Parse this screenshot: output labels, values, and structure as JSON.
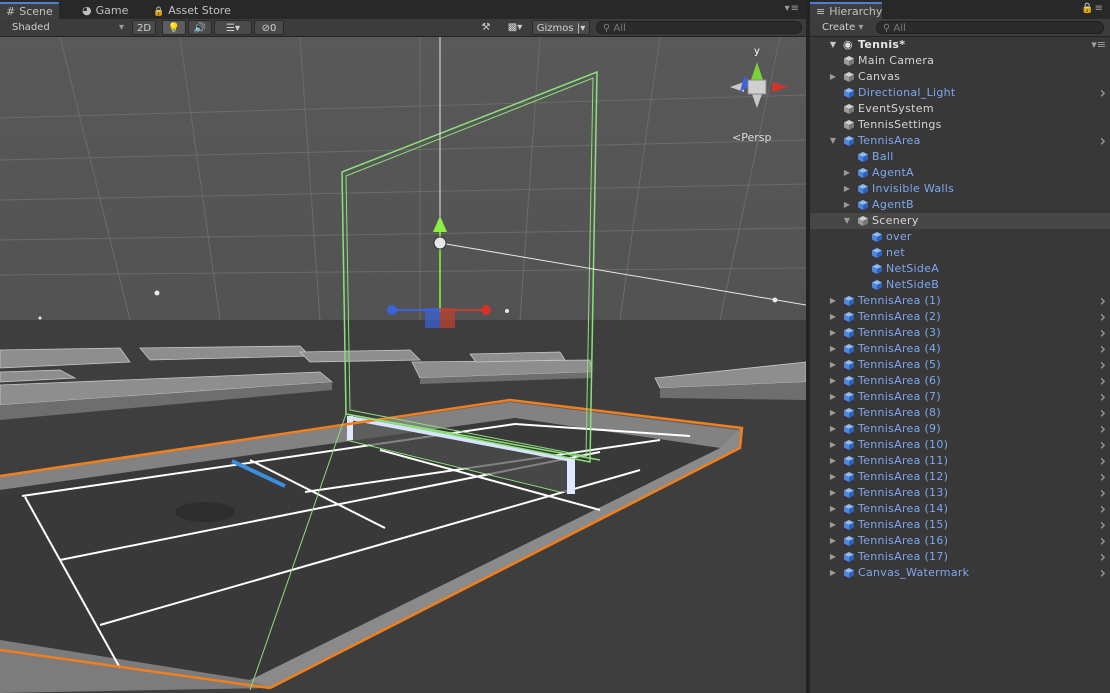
{
  "scene_panel": {
    "tabs": [
      {
        "label": "Scene",
        "icon": "grid-icon",
        "active": true
      },
      {
        "label": "Game",
        "icon": "pacman-icon",
        "active": false
      },
      {
        "label": "Asset Store",
        "icon": "lock-icon",
        "active": false
      }
    ],
    "toolbar": {
      "shading_mode": "Shaded",
      "mode_2d": "2D",
      "hidden_count": "0",
      "gizmos_label": "Gizmos",
      "search_placeholder": "All"
    },
    "view_mode": "Persp",
    "gizmo_axis_label": "y"
  },
  "hierarchy": {
    "title": "Hierarchy",
    "create_label": "Create",
    "search_placeholder": "All",
    "scene_name": "Tennis*",
    "rows": [
      {
        "label": "Main Camera",
        "depth": 1,
        "expander": "none",
        "prefab": false,
        "selected": false
      },
      {
        "label": "Canvas",
        "depth": 1,
        "expander": "collapsed",
        "prefab": false,
        "selected": false
      },
      {
        "label": "Directional_Light",
        "depth": 1,
        "expander": "none",
        "prefab": true,
        "selected": false,
        "more": true
      },
      {
        "label": "EventSystem",
        "depth": 1,
        "expander": "none",
        "prefab": false,
        "selected": false
      },
      {
        "label": "TennisSettings",
        "depth": 1,
        "expander": "none",
        "prefab": false,
        "selected": false
      },
      {
        "label": "TennisArea",
        "depth": 1,
        "expander": "expanded",
        "prefab": true,
        "selected": false,
        "more": true
      },
      {
        "label": "Ball",
        "depth": 2,
        "expander": "none",
        "prefab": true,
        "selected": false
      },
      {
        "label": "AgentA",
        "depth": 2,
        "expander": "collapsed",
        "prefab": true,
        "selected": false
      },
      {
        "label": "Invisible Walls",
        "depth": 2,
        "expander": "collapsed",
        "prefab": true,
        "selected": false
      },
      {
        "label": "AgentB",
        "depth": 2,
        "expander": "collapsed",
        "prefab": true,
        "selected": false
      },
      {
        "label": "Scenery",
        "depth": 2,
        "expander": "expanded",
        "prefab": false,
        "selected": true
      },
      {
        "label": "over",
        "depth": 3,
        "expander": "none",
        "prefab": true,
        "selected": false
      },
      {
        "label": "net",
        "depth": 3,
        "expander": "none",
        "prefab": true,
        "selected": false
      },
      {
        "label": "NetSideA",
        "depth": 3,
        "expander": "none",
        "prefab": true,
        "selected": false
      },
      {
        "label": "NetSideB",
        "depth": 3,
        "expander": "none",
        "prefab": true,
        "selected": false
      },
      {
        "label": "TennisArea (1)",
        "depth": 1,
        "expander": "collapsed",
        "prefab": true,
        "selected": false,
        "more": true
      },
      {
        "label": "TennisArea (2)",
        "depth": 1,
        "expander": "collapsed",
        "prefab": true,
        "selected": false,
        "more": true
      },
      {
        "label": "TennisArea (3)",
        "depth": 1,
        "expander": "collapsed",
        "prefab": true,
        "selected": false,
        "more": true
      },
      {
        "label": "TennisArea (4)",
        "depth": 1,
        "expander": "collapsed",
        "prefab": true,
        "selected": false,
        "more": true
      },
      {
        "label": "TennisArea (5)",
        "depth": 1,
        "expander": "collapsed",
        "prefab": true,
        "selected": false,
        "more": true
      },
      {
        "label": "TennisArea (6)",
        "depth": 1,
        "expander": "collapsed",
        "prefab": true,
        "selected": false,
        "more": true
      },
      {
        "label": "TennisArea (7)",
        "depth": 1,
        "expander": "collapsed",
        "prefab": true,
        "selected": false,
        "more": true
      },
      {
        "label": "TennisArea (8)",
        "depth": 1,
        "expander": "collapsed",
        "prefab": true,
        "selected": false,
        "more": true
      },
      {
        "label": "TennisArea (9)",
        "depth": 1,
        "expander": "collapsed",
        "prefab": true,
        "selected": false,
        "more": true
      },
      {
        "label": "TennisArea (10)",
        "depth": 1,
        "expander": "collapsed",
        "prefab": true,
        "selected": false,
        "more": true
      },
      {
        "label": "TennisArea (11)",
        "depth": 1,
        "expander": "collapsed",
        "prefab": true,
        "selected": false,
        "more": true
      },
      {
        "label": "TennisArea (12)",
        "depth": 1,
        "expander": "collapsed",
        "prefab": true,
        "selected": false,
        "more": true
      },
      {
        "label": "TennisArea (13)",
        "depth": 1,
        "expander": "collapsed",
        "prefab": true,
        "selected": false,
        "more": true
      },
      {
        "label": "TennisArea (14)",
        "depth": 1,
        "expander": "collapsed",
        "prefab": true,
        "selected": false,
        "more": true
      },
      {
        "label": "TennisArea (15)",
        "depth": 1,
        "expander": "collapsed",
        "prefab": true,
        "selected": false,
        "more": true
      },
      {
        "label": "TennisArea (16)",
        "depth": 1,
        "expander": "collapsed",
        "prefab": true,
        "selected": false,
        "more": true
      },
      {
        "label": "TennisArea (17)",
        "depth": 1,
        "expander": "collapsed",
        "prefab": true,
        "selected": false,
        "more": true
      },
      {
        "label": "Canvas_Watermark",
        "depth": 1,
        "expander": "collapsed",
        "prefab": true,
        "selected": false,
        "more": true
      }
    ]
  },
  "colors": {
    "prefab_text": "#7fa7ee",
    "selection_outline": "#f07f1e",
    "collider_green": "#8ce07a",
    "axis_x": "#d2332b",
    "axis_y": "#7ad13a",
    "axis_z": "#3a63dd",
    "active_tab_accent": "#4c7fd1"
  }
}
